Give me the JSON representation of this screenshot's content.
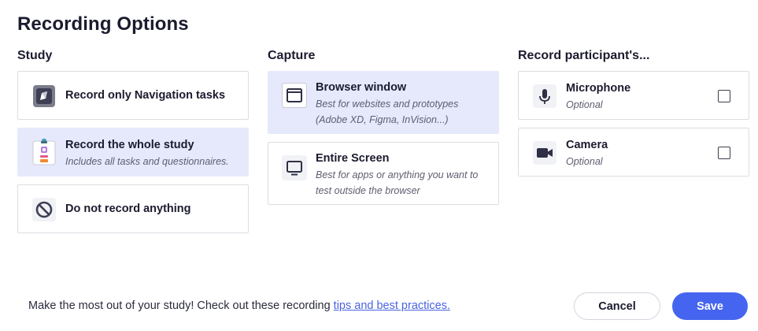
{
  "title": "Recording Options",
  "study": {
    "heading": "Study",
    "options": [
      {
        "title": "Record only Navigation tasks",
        "description": "",
        "icon": "navigation-task-icon",
        "selected": false
      },
      {
        "title": "Record the whole study",
        "description": "Includes all tasks and questionnaires.",
        "icon": "clipboard-icon",
        "selected": true
      },
      {
        "title": "Do not record anything",
        "description": "",
        "icon": "prohibited-icon",
        "selected": false
      }
    ]
  },
  "capture": {
    "heading": "Capture",
    "options": [
      {
        "title": "Browser window",
        "description": "Best for websites and prototypes (Adobe XD, Figma, InVision...)",
        "icon": "browser-window-icon",
        "selected": true
      },
      {
        "title": "Entire Screen",
        "description": "Best for apps or anything you want to test outside the browser",
        "icon": "monitor-icon",
        "selected": false
      }
    ]
  },
  "record": {
    "heading": "Record participant's...",
    "options": [
      {
        "title": "Microphone",
        "description": "Optional",
        "icon": "microphone-icon",
        "checked": false
      },
      {
        "title": "Camera",
        "description": "Optional",
        "icon": "camera-icon",
        "checked": false
      }
    ]
  },
  "footer": {
    "text": "Make the most out of your study! Check out these recording ",
    "link": "tips and best practices."
  },
  "buttons": {
    "cancel": "Cancel",
    "save": "Save"
  },
  "colors": {
    "accent": "#4565f0",
    "selected_bg": "#e5e9fb",
    "link": "#4a63e0"
  }
}
